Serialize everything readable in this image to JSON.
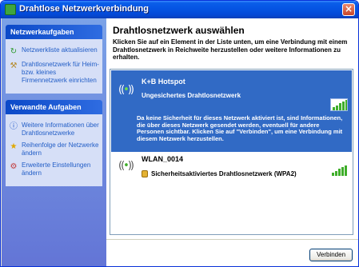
{
  "window": {
    "title": "Drahtlose Netzwerkverbindung",
    "close_glyph": "×"
  },
  "taskpane": {
    "network_tasks": {
      "heading": "Netzwerkaufgaben",
      "items": [
        {
          "label": "Netzwerkliste aktualisieren",
          "icon": "refresh-icon"
        },
        {
          "label": "Drahtlosnetzwerk für Heim- bzw. kleines Firmennetzwerk einrichten",
          "icon": "setup-wizard-icon"
        }
      ]
    },
    "related_tasks": {
      "heading": "Verwandte Aufgaben",
      "items": [
        {
          "label": "Weitere Informationen über Drahtlosnetzwerke",
          "icon": "info-icon"
        },
        {
          "label": "Reihenfolge der Netzwerke ändern",
          "icon": "star-icon"
        },
        {
          "label": "Erweiterte Einstellungen ändern",
          "icon": "settings-icon"
        }
      ]
    }
  },
  "main": {
    "title": "Drahtlosnetzwerk auswählen",
    "description": "Klicken Sie auf ein Element in der Liste unten, um eine Verbindung mit einem Drahtlosnetzwerk in Reichweite herzustellen oder weitere Informationen zu erhalten."
  },
  "networks": [
    {
      "name": "K+B Hotspot",
      "security": "Ungesichertes Drahtlosnetzwerk",
      "info": "Da keine Sicherheit für dieses Netzwerk aktiviert ist, sind Informationen, die über dieses Netzwerk gesendet werden, eventuell für andere Personen sichtbar. Klicken Sie auf \"Verbinden\", um eine Verbindung mit diesem Netzwerk herzustellen.",
      "selected": true
    },
    {
      "name": "WLAN_0014",
      "security": "Sicherheitsaktiviertes Drahtlosnetzwerk (WPA2)",
      "selected": false
    }
  ],
  "footer": {
    "connect_label": "Verbinden"
  },
  "colors": {
    "selection": "#316ac5",
    "task_link": "#215dc6",
    "signal_green": "#3fae2a"
  }
}
